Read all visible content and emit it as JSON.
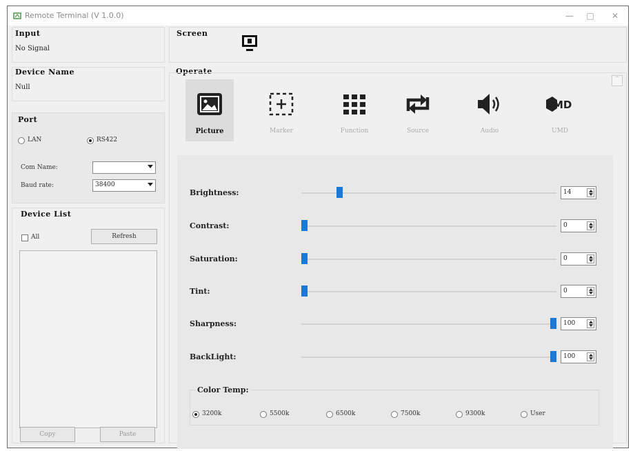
{
  "window": {
    "title": "Remote Terminal (V 1.0.0)",
    "minimize": "—",
    "maximize": "□",
    "close": "✕"
  },
  "input": {
    "title": "Input",
    "value": "No Signal"
  },
  "device_name": {
    "title": "Device Name",
    "value": "Null"
  },
  "port": {
    "title": "Port",
    "options": [
      {
        "label": "LAN",
        "selected": false
      },
      {
        "label": "RS422",
        "selected": true
      }
    ],
    "com_name_label": "Com Name:",
    "com_name_value": "",
    "baud_rate_label": "Baud rate:",
    "baud_rate_value": "38400"
  },
  "device_list": {
    "title": "Device List",
    "all_label": "All",
    "refresh_label": "Refresh",
    "copy_label": "Copy",
    "paste_label": "Paste"
  },
  "screen": {
    "title": "Screen",
    "icon": "monitor-icon"
  },
  "operate": {
    "title": "Operate",
    "tabs": [
      {
        "label": "Picture",
        "icon": "picture-icon",
        "selected": true
      },
      {
        "label": "Marker",
        "icon": "marker-icon",
        "selected": false
      },
      {
        "label": "Function",
        "icon": "function-icon",
        "selected": false
      },
      {
        "label": "Source",
        "icon": "source-icon",
        "selected": false
      },
      {
        "label": "Audio",
        "icon": "audio-icon",
        "selected": false
      },
      {
        "label": "UMD",
        "icon": "umd-icon",
        "selected": false
      }
    ]
  },
  "picture": {
    "sliders": [
      {
        "label": "Brightness:",
        "value": "14",
        "level": 0.14
      },
      {
        "label": "Contrast:",
        "value": "0",
        "level": 0
      },
      {
        "label": "Saturation:",
        "value": "0",
        "level": 0
      },
      {
        "label": "Tint:",
        "value": "0",
        "level": 0
      },
      {
        "label": "Sharpness:",
        "value": "100",
        "level": 1.0
      },
      {
        "label": "BackLight:",
        "value": "100",
        "level": 1.0
      }
    ],
    "color_temp": {
      "title": "Color Temp:",
      "options": [
        {
          "label": "3200k",
          "selected": true
        },
        {
          "label": "5500k",
          "selected": false
        },
        {
          "label": "6500k",
          "selected": false
        },
        {
          "label": "7500k",
          "selected": false
        },
        {
          "label": "9300k",
          "selected": false
        },
        {
          "label": "User",
          "selected": false
        }
      ]
    }
  },
  "colors": {
    "accent": "#1c78d4",
    "selected_tab_bg": "#dcdcdc",
    "icon_dark": "#222222",
    "panel_bg": "#e8e8e8"
  }
}
